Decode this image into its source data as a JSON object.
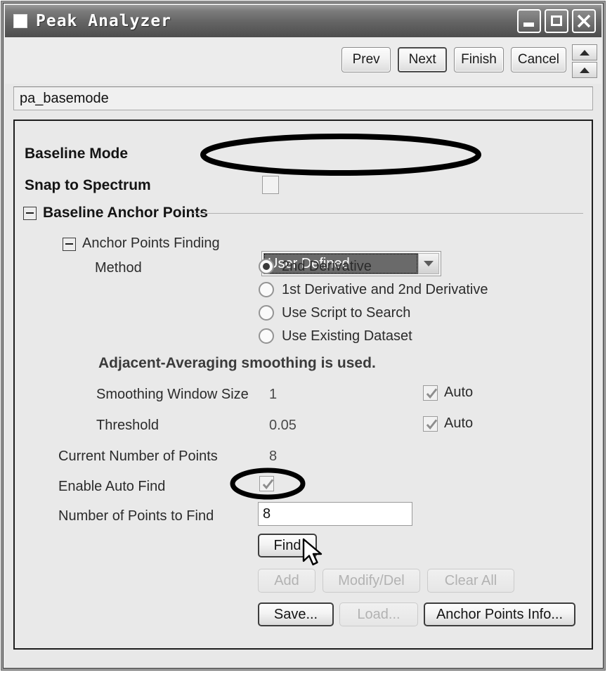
{
  "window": {
    "title": "Peak Analyzer",
    "icon": "app-square-icon",
    "buttons": {
      "minimize": "minimize-icon",
      "maximize": "maximize-icon",
      "close": "close-icon"
    }
  },
  "toolbar": {
    "prev": "Prev",
    "next": "Next",
    "finish": "Finish",
    "cancel": "Cancel",
    "scroll_up_1": "scroll-up-icon",
    "scroll_up_2": "scroll-up-icon"
  },
  "path_bar": {
    "value": "pa_basemode"
  },
  "form": {
    "baseline_mode_label": "Baseline Mode",
    "baseline_mode_value": "User Defined",
    "snap_to_spectrum_label": "Snap to Spectrum",
    "snap_to_spectrum_checked": false,
    "group_baseline_anchor_points": "Baseline Anchor Points",
    "group_anchor_points_finding": "Anchor Points Finding",
    "method_label": "Method",
    "method_options": [
      "2nd Derivative",
      "1st Derivative and 2nd Derivative",
      "Use Script to Search",
      "Use Existing Dataset"
    ],
    "method_selected": "2nd Derivative",
    "smoothing_note": "Adjacent-Averaging smoothing is used.",
    "smoothing_window_label": "Smoothing Window Size",
    "smoothing_window_value": "1",
    "smoothing_window_auto_label": "Auto",
    "threshold_label": "Threshold",
    "threshold_value": "0.05",
    "threshold_auto_label": "Auto",
    "current_points_label": "Current Number of Points",
    "current_points_value": "8",
    "enable_auto_find_label": "Enable Auto Find",
    "enable_auto_find_checked": true,
    "points_to_find_label": "Number of Points to Find",
    "points_to_find_value": "8"
  },
  "actions": {
    "find": "Find",
    "add": "Add",
    "modify_del": "Modify/Del",
    "clear_all": "Clear All",
    "save": "Save...",
    "load": "Load...",
    "anchor_points_info": "Anchor Points Info..."
  },
  "annotations": {
    "ellipse_combo": "highlight-ellipse-baseline-mode",
    "ellipse_checkbox": "highlight-ellipse-enable-auto-find",
    "cursor": "mouse-pointer-icon"
  },
  "colors": {
    "window_bg": "#e9e9e9",
    "titlebar_dark": "#4e4e4e",
    "selection_gray": "#6a6a6a",
    "annotation_black": "#000000",
    "disabled_text": "#b2b2b2"
  }
}
